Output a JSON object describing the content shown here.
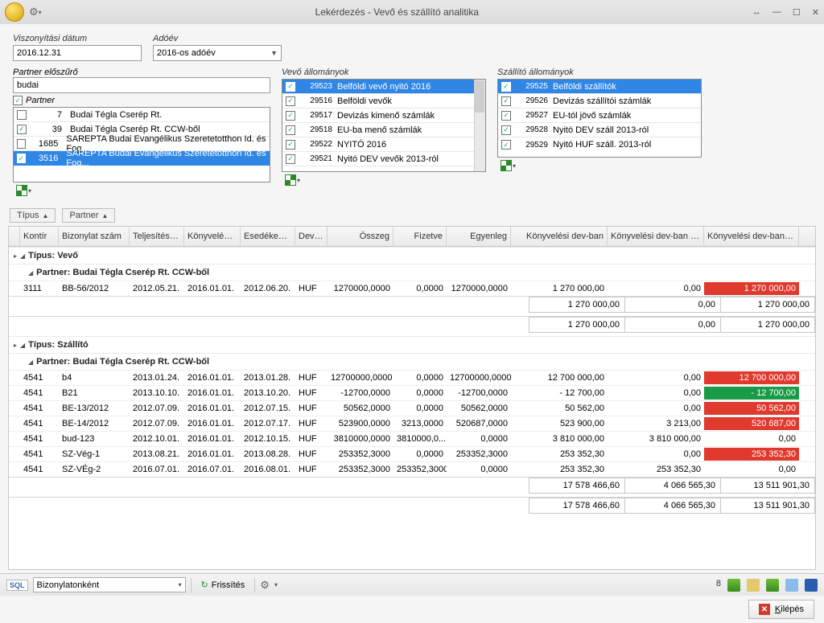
{
  "window": {
    "title": "Lekérdezés - Vevő és szállító analitika"
  },
  "filters": {
    "viszonyitasi_datum_label": "Viszonyítási dátum",
    "viszonyitasi_datum": "2016.12.31",
    "adoev_label": "Adóév",
    "adoev": "2016-os adóév",
    "partner_eloszuro_label": "Partner előszűrő",
    "partner_eloszuro": "budai"
  },
  "partner_panel": {
    "title": "Partner",
    "rows": [
      {
        "checked": false,
        "id": "7",
        "name": "Budai Tégla Cserép Rt."
      },
      {
        "checked": true,
        "id": "39",
        "name": "Budai Tégla Cserép Rt. CCW-ből"
      },
      {
        "checked": false,
        "id": "1685",
        "name": "SAREPTA Budai Evangélikus Szeretetotthon Id. és Fog..."
      },
      {
        "checked": true,
        "id": "3516",
        "name": "SAREPTA Budai Evangélikus Szeretetotthon Id. és Fog...",
        "selected": true
      }
    ]
  },
  "vevo_all": {
    "title": "Vevő állományok",
    "items": [
      {
        "checked": true,
        "id": "29523",
        "name": "Belföldi vevő nyitó 2016",
        "selected": true
      },
      {
        "checked": true,
        "id": "29516",
        "name": "Belföldi vevők"
      },
      {
        "checked": true,
        "id": "29517",
        "name": "Devizás kimenő számlák"
      },
      {
        "checked": true,
        "id": "29518",
        "name": "EU-ba menő számlák"
      },
      {
        "checked": true,
        "id": "29522",
        "name": "NYITÓ 2016"
      },
      {
        "checked": true,
        "id": "29521",
        "name": "Nyitó DEV vevők 2013-ról"
      }
    ]
  },
  "szall_all": {
    "title": "Szállító állományok",
    "items": [
      {
        "checked": true,
        "id": "29525",
        "name": "Belföldi szállítók",
        "selected": true
      },
      {
        "checked": true,
        "id": "29526",
        "name": "Devizás szállítói számlák"
      },
      {
        "checked": true,
        "id": "29527",
        "name": "EU-tól jövő számlák"
      },
      {
        "checked": true,
        "id": "29528",
        "name": "Nyitó DEV száll 2013-ról"
      },
      {
        "checked": true,
        "id": "29529",
        "name": "Nyitó HUF száll. 2013-ról"
      }
    ]
  },
  "tagbar": {
    "tipus": "Típus",
    "partner": "Partner"
  },
  "grid": {
    "headers": {
      "kontir": "Kontír",
      "biz": "Bizonylat szám",
      "telj": "Teljesítési d...",
      "kony": "Könyvelési ...",
      "esed": "Esedékesség",
      "dev": "Deviza",
      "ossz": "Összeg",
      "fiz": "Fizetve",
      "egy": "Egyenleg",
      "kdb": "Könyvelési dev-ban",
      "kdbf": "Könyvelési dev-ban fizetve",
      "kdbe": "Könyvelési dev-ban eg..."
    },
    "groups": [
      {
        "title": "Típus: Vevő",
        "partners": [
          {
            "title": "Partner: Budai Tégla Cserép Rt. CCW-ből",
            "rows": [
              {
                "kontir": "3111",
                "biz": "BB-56/2012",
                "telj": "2012.05.21.",
                "kony": "2016.01.01.",
                "esed": "2012.06.20.",
                "dev": "HUF",
                "ossz": "1270000,0000",
                "fiz": "0,0000",
                "egy": "1270000,0000",
                "kdb": "1 270 000,00",
                "kdbf": "0,00",
                "kdbe": "1 270 000,00",
                "kdbe_bg": "red"
              }
            ],
            "subtotal": {
              "kdb": "1 270 000,00",
              "kdbf": "0,00",
              "kdbe": "1 270 000,00"
            }
          }
        ],
        "subtotal": {
          "kdb": "1 270 000,00",
          "kdbf": "0,00",
          "kdbe": "1 270 000,00"
        }
      },
      {
        "title": "Típus: Szállító",
        "partners": [
          {
            "title": "Partner: Budai Tégla Cserép Rt. CCW-ből",
            "rows": [
              {
                "kontir": "4541",
                "biz": "b4",
                "telj": "2013.01.24.",
                "kony": "2016.01.01.",
                "esed": "2013.01.28.",
                "dev": "HUF",
                "ossz": "12700000,0000",
                "fiz": "0,0000",
                "egy": "12700000,0000",
                "kdb": "12 700 000,00",
                "kdbf": "0,00",
                "kdbe": "12 700 000,00",
                "kdbe_bg": "red"
              },
              {
                "kontir": "4541",
                "biz": "B21",
                "telj": "2013.10.10.",
                "kony": "2016.01.01.",
                "esed": "2013.10.20.",
                "dev": "HUF",
                "ossz": "-12700,0000",
                "fiz": "0,0000",
                "egy": "-12700,0000",
                "kdb": "- 12 700,00",
                "kdbf": "0,00",
                "kdbe": "- 12 700,00",
                "kdbe_bg": "green"
              },
              {
                "kontir": "4541",
                "biz": "BE-13/2012",
                "telj": "2012.07.09.",
                "kony": "2016.01.01.",
                "esed": "2012.07.15.",
                "dev": "HUF",
                "ossz": "50562,0000",
                "fiz": "0,0000",
                "egy": "50562,0000",
                "kdb": "50 562,00",
                "kdbf": "0,00",
                "kdbe": "50 562,00",
                "kdbe_bg": "red"
              },
              {
                "kontir": "4541",
                "biz": "BE-14/2012",
                "telj": "2012.07.09.",
                "kony": "2016.01.01.",
                "esed": "2012.07.17.",
                "dev": "HUF",
                "ossz": "523900,0000",
                "fiz": "3213,0000",
                "egy": "520687,0000",
                "kdb": "523 900,00",
                "kdbf": "3 213,00",
                "kdbe": "520 687,00",
                "kdbe_bg": "red"
              },
              {
                "kontir": "4541",
                "biz": "bud-123",
                "telj": "2012.10.01.",
                "kony": "2016.01.01.",
                "esed": "2012.10.15.",
                "dev": "HUF",
                "ossz": "3810000,0000",
                "fiz": "3810000,0...",
                "egy": "0,0000",
                "kdb": "3 810 000,00",
                "kdbf": "3 810 000,00",
                "kdbe": "0,00",
                "kdbe_bg": "white"
              },
              {
                "kontir": "4541",
                "biz": "SZ-Vég-1",
                "telj": "2013.08.21.",
                "kony": "2016.01.01.",
                "esed": "2013.08.28.",
                "dev": "HUF",
                "ossz": "253352,3000",
                "fiz": "0,0000",
                "egy": "253352,3000",
                "kdb": "253 352,30",
                "kdbf": "0,00",
                "kdbe": "253 352,30",
                "kdbe_bg": "red"
              },
              {
                "kontir": "4541",
                "biz": "SZ-VÉg-2",
                "telj": "2016.07.01.",
                "kony": "2016.07.01.",
                "esed": "2016.08.01.",
                "dev": "HUF",
                "ossz": "253352,3000",
                "fiz": "253352,3000",
                "egy": "0,0000",
                "kdb": "253 352,30",
                "kdbf": "253 352,30",
                "kdbe": "0,00",
                "kdbe_bg": "white"
              }
            ],
            "subtotal": {
              "kdb": "17 578 466,60",
              "kdbf": "4 066 565,30",
              "kdbe": "13 511 901,30"
            }
          }
        ],
        "subtotal": {
          "kdb": "17 578 466,60",
          "kdbf": "4 066 565,30",
          "kdbe": "13 511 901,30"
        }
      }
    ]
  },
  "statusbar": {
    "sql": "SQL",
    "mode": "Bizonylatonként",
    "refresh": "Frissítés",
    "count": "8"
  },
  "footer": {
    "exit": "Kilépés"
  }
}
